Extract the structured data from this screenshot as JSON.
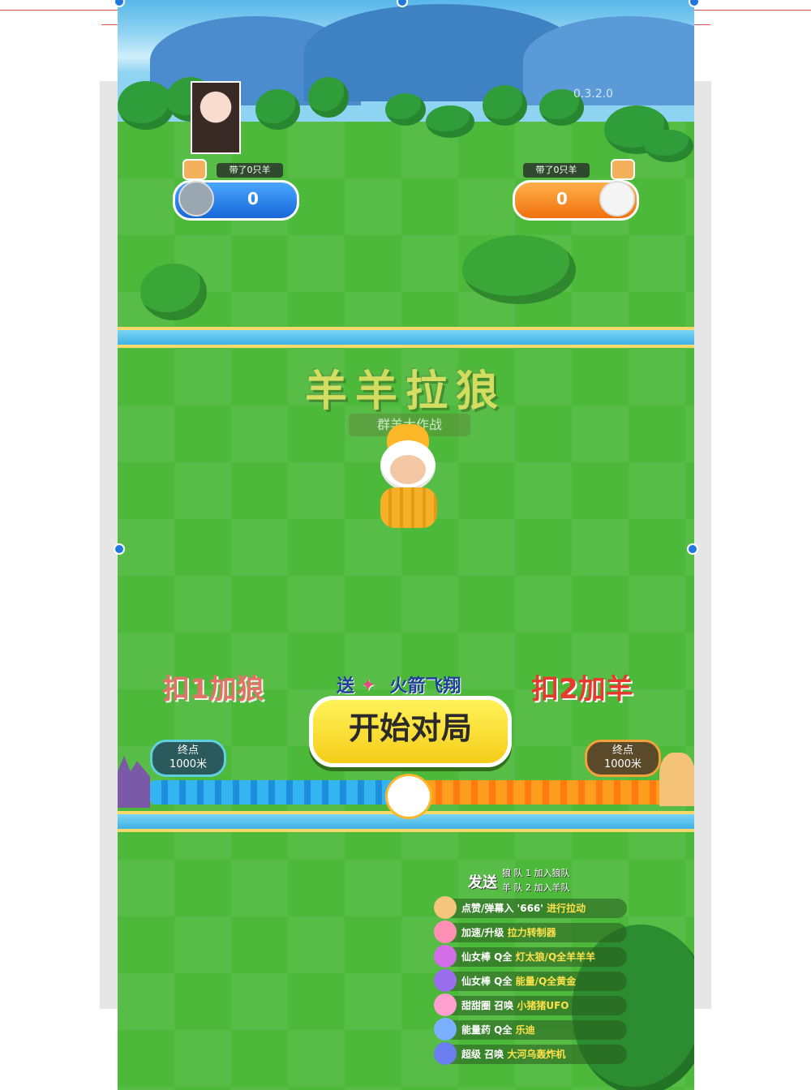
{
  "game": {
    "version": "0.3.2.0",
    "team_left": {
      "label": "带了0只羊",
      "score": "0"
    },
    "team_right": {
      "label": "带了0只羊",
      "score": "0"
    },
    "logo": {
      "line1": "羊羊拉狼",
      "line2": "群羊大作战"
    },
    "left_action": "扣1加狼",
    "right_action": "扣2加羊",
    "promo": {
      "send": "送",
      "rocket_label": "火箭飞翔"
    },
    "start_button": "开始对局",
    "end_left": {
      "line1": "终点",
      "line2": "1000米"
    },
    "end_right": {
      "line1": "终点",
      "line2": "1000米"
    }
  },
  "hints": {
    "send": "发送",
    "wolf_row": "狼 队 1 加入狼队",
    "sheep_row": "羊 队 2 加入羊队"
  },
  "gift_list": [
    {
      "text": "点赞/弹幕入 '666' ",
      "hl": "进行拉动",
      "color": "#f6c47a"
    },
    {
      "text": "加速/升级 ",
      "hl": "拉力转制器",
      "color": "#ff8fb5"
    },
    {
      "text": "仙女棒 Q全 ",
      "hl": "灯太狼/Q全羊羊羊",
      "color": "#d46ee8"
    },
    {
      "text": "仙女棒 Q全 ",
      "hl": "能量/Q全黄金",
      "color": "#9b6ef0"
    },
    {
      "text": "甜甜圈 召唤 ",
      "hl": "小猪猪UFO",
      "color": "#ff9fd0"
    },
    {
      "text": "能量药 Q全 ",
      "hl": "乐迪",
      "color": "#7ab0ff"
    },
    {
      "text": "超级 召唤 ",
      "hl": "大河乌轰炸机",
      "color": "#6a7ef0"
    }
  ]
}
